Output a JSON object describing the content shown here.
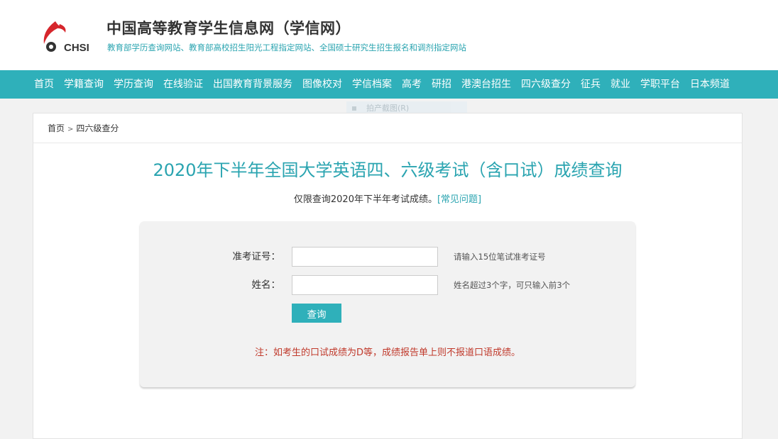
{
  "header": {
    "logo_text": "CHSI",
    "title": "中国高等教育学生信息网（学信网）",
    "subtitle": "教育部学历查询网站、教育部高校招生阳光工程指定网站、全国硕士研究生招生报名和调剂指定网站"
  },
  "nav": {
    "items": [
      "首页",
      "学籍查询",
      "学历查询",
      "在线验证",
      "出国教育背景服务",
      "图像校对",
      "学信档案",
      "高考",
      "研招",
      "港澳台招生",
      "四六级查分",
      "征兵",
      "就业",
      "学职平台",
      "日本频道"
    ]
  },
  "ghost_menu": {
    "label": "拍产截图(R)"
  },
  "breadcrumb": {
    "home": "首页",
    "separator": ">",
    "current": "四六级查分"
  },
  "main": {
    "title": "2020年下半年全国大学英语四、六级考试（含口试）成绩查询",
    "notice_text": "仅限查询2020年下半年考试成绩。",
    "notice_link": "[常见问题]"
  },
  "form": {
    "exam_id": {
      "label": "准考证号：",
      "value": "",
      "hint": "请输入15位笔试准考证号"
    },
    "name": {
      "label": "姓名：",
      "value": "",
      "hint": "姓名超过3个字，可只输入前3个"
    },
    "submit_label": "查询",
    "note": "注：如考生的口试成绩为D等，成绩报告单上则不报道口语成绩。"
  },
  "colors": {
    "accent": "#2fb0ba",
    "title": "#2aa4b0",
    "note": "#c0392b"
  }
}
